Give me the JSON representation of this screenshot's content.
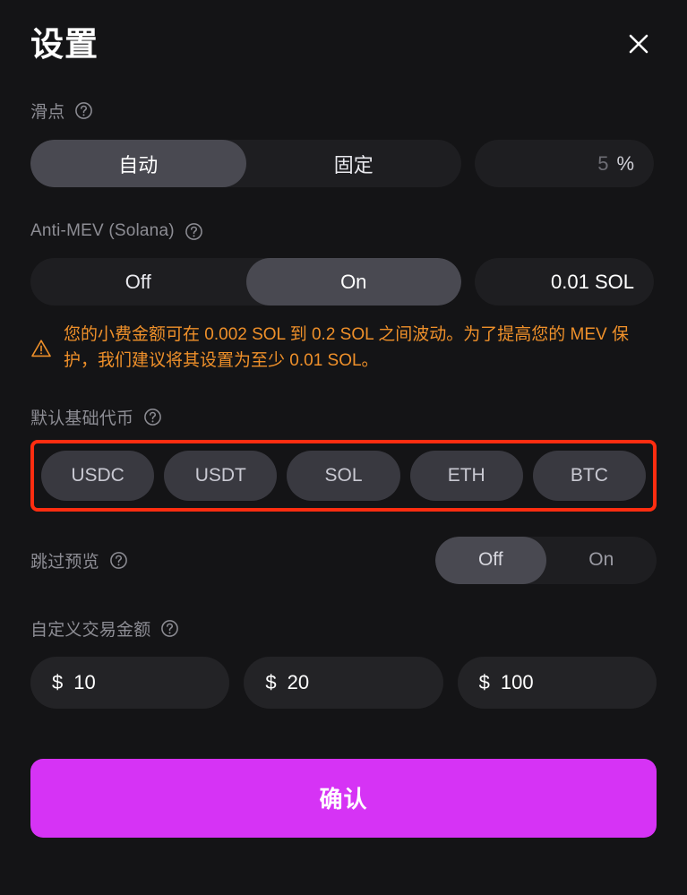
{
  "header": {
    "title": "设置",
    "close_label": "×"
  },
  "slippage": {
    "label": "滑点",
    "help_icon": "help-circle-icon",
    "options": [
      {
        "label": "自动",
        "active": true
      },
      {
        "label": "固定",
        "active": false
      }
    ],
    "value_placeholder": "5",
    "unit": "%"
  },
  "anti_mev": {
    "label": "Anti-MEV (Solana)",
    "help_icon": "help-circle-icon",
    "options": [
      {
        "label": "Off",
        "active": false
      },
      {
        "label": "On",
        "active": true
      }
    ],
    "value": "0.01 SOL",
    "warning_icon": "warning-triangle-icon",
    "warning_text": "您的小费金额可在 0.002 SOL 到 0.2 SOL 之间波动。为了提高您的 MEV 保护，我们建议将其设置为至少 0.01 SOL。"
  },
  "base_token": {
    "label": "默认基础代币",
    "help_icon": "help-circle-icon",
    "highlighted": true,
    "highlight_color": "#ff2d10",
    "tokens": [
      {
        "label": "USDC"
      },
      {
        "label": "USDT"
      },
      {
        "label": "SOL"
      },
      {
        "label": "ETH"
      },
      {
        "label": "BTC"
      }
    ]
  },
  "skip_preview": {
    "label": "跳过预览",
    "help_icon": "help-circle-icon",
    "options": [
      {
        "label": "Off",
        "active": true
      },
      {
        "label": "On",
        "active": false
      }
    ]
  },
  "custom_amount": {
    "label": "自定义交易金额",
    "help_icon": "help-circle-icon",
    "currency_symbol": "$",
    "amounts": [
      {
        "value": "10"
      },
      {
        "value": "20"
      },
      {
        "value": "100"
      }
    ]
  },
  "footer": {
    "confirm_label": "确认"
  },
  "colors": {
    "background": "#141416",
    "accent": "#d633f5",
    "warning": "#ef902a",
    "highlight": "#ff2d10",
    "track": "#1e1e21",
    "active_segment": "#494951",
    "token_pill": "#393940"
  }
}
